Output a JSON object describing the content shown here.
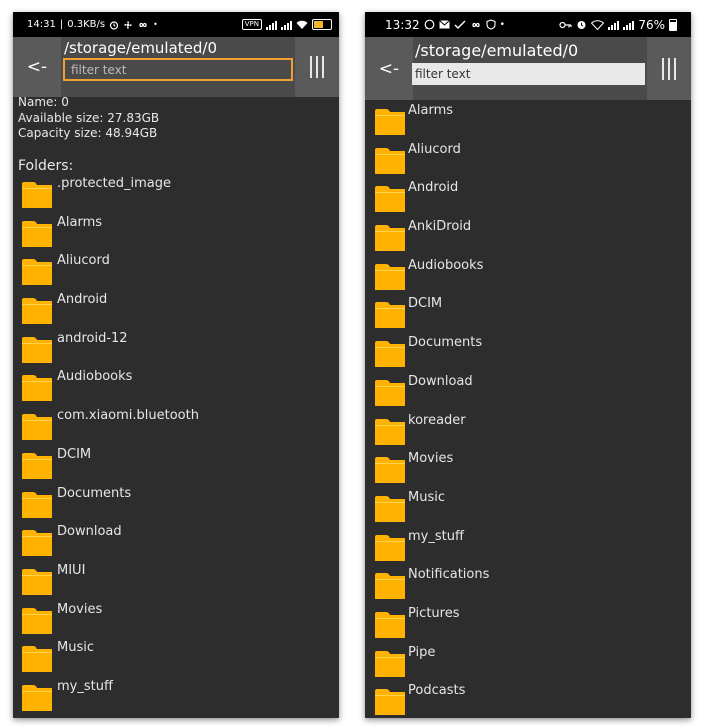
{
  "left_screen": {
    "status_bar": {
      "time": "14:31",
      "net_speed": "0.3KB/s",
      "vpn_label": "VPN",
      "icons": [
        "alarm-icon",
        "fan-icon",
        "infinity-icon",
        "dot-icon",
        "signal-icon",
        "wifi-icon",
        "battery-icon"
      ],
      "battery_color": "#f3b52c"
    },
    "toolbar": {
      "back_label": "<-",
      "path": "/storage/emulated/0",
      "filter_placeholder": "filter text",
      "menu_icon": "columns-menu-icon",
      "filter_border_color": "#f0a030"
    },
    "info": {
      "name": "Name: 0",
      "available": "Available size: 27.83GB",
      "capacity": "Capacity size: 48.94GB"
    },
    "folders_heading": "Folders:",
    "folders": [
      ".protected_image",
      "Alarms",
      "Aliucord",
      "Android",
      "android-12",
      "Audiobooks",
      "com.xiaomi.bluetooth",
      "DCIM",
      "Documents",
      "Download",
      "MIUI",
      "Movies",
      "Music",
      "my_stuff"
    ]
  },
  "right_screen": {
    "status_bar": {
      "time": "13:32",
      "battery": "76%",
      "icons": [
        "whatsapp-icon",
        "mail-icon",
        "check-icon",
        "infinity-icon",
        "shield-icon",
        "dot-icon",
        "key-icon",
        "alarm-icon",
        "wifi-icon",
        "signal-icon",
        "battery-icon"
      ]
    },
    "toolbar": {
      "back_label": "<-",
      "path": "/storage/emulated/0",
      "filter_placeholder": "filter text",
      "menu_icon": "columns-menu-icon"
    },
    "folders": [
      "Alarms",
      "Aliucord",
      "Android",
      "AnkiDroid",
      "Audiobooks",
      "DCIM",
      "Documents",
      "Download",
      "koreader",
      "Movies",
      "Music",
      "my_stuff",
      "Notifications",
      "Pictures",
      "Pipe",
      "Podcasts"
    ]
  },
  "colors": {
    "background": "#2d2d2d",
    "toolbar": "#4a4a4a",
    "button": "#5a5a5a",
    "folder": "#ffb300"
  }
}
